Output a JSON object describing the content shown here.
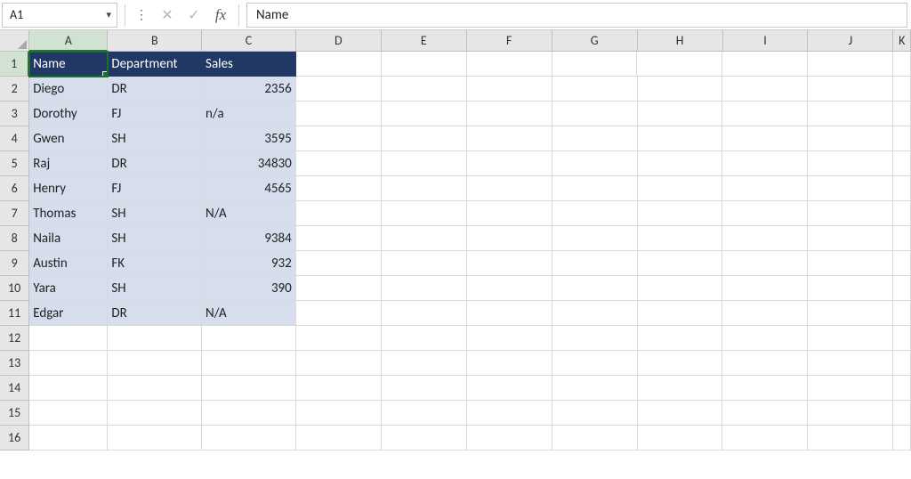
{
  "formula_bar": {
    "name_box_value": "A1",
    "cancel_icon": "✕",
    "enter_icon": "✓",
    "fx_label": "fx",
    "formula_value": "Name"
  },
  "columns": [
    "A",
    "B",
    "C",
    "D",
    "E",
    "F",
    "G",
    "H",
    "I",
    "J",
    "K"
  ],
  "active_column": "A",
  "active_row": "1",
  "row_count_visible": 16,
  "table": {
    "headers": {
      "A": "Name",
      "B": "Department",
      "C": "Sales"
    },
    "rows": [
      {
        "A": "Diego",
        "B": "DR",
        "C": "2356",
        "C_numeric": true
      },
      {
        "A": "Dorothy",
        "B": "FJ",
        "C": "n/a",
        "C_numeric": false
      },
      {
        "A": "Gwen",
        "B": "SH",
        "C": "3595",
        "C_numeric": true
      },
      {
        "A": "Raj",
        "B": "DR",
        "C": "34830",
        "C_numeric": true
      },
      {
        "A": "Henry",
        "B": "FJ",
        "C": "4565",
        "C_numeric": true
      },
      {
        "A": "Thomas",
        "B": "SH",
        "C": "N/A",
        "C_numeric": false
      },
      {
        "A": "Naila",
        "B": "SH",
        "C": "9384",
        "C_numeric": true
      },
      {
        "A": "Austin",
        "B": "FK",
        "C": "932",
        "C_numeric": true
      },
      {
        "A": "Yara",
        "B": "SH",
        "C": "390",
        "C_numeric": true
      },
      {
        "A": "Edgar",
        "B": "DR",
        "C": "N/A",
        "C_numeric": false
      }
    ]
  }
}
